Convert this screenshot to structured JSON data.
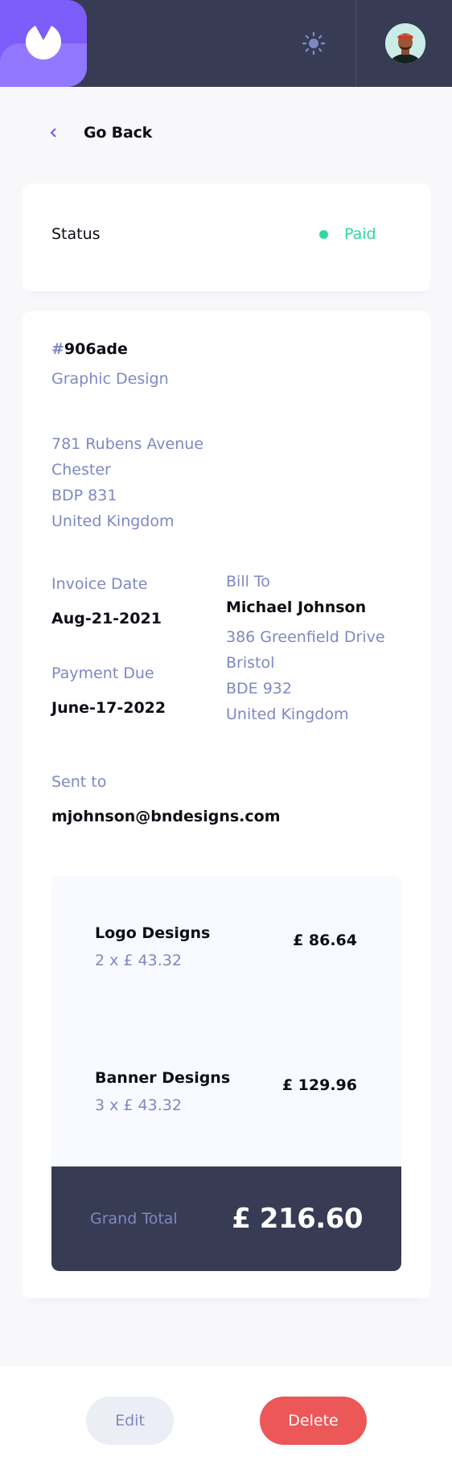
{
  "header": {
    "logo_icon": "logo-mark-icon",
    "theme_icon": "sun-icon",
    "avatar_alt": "user-avatar"
  },
  "nav": {
    "go_back_label": "Go Back",
    "go_back_icon": "chevron-left-icon"
  },
  "status": {
    "label": "Status",
    "value": "Paid",
    "color": "#33d69f"
  },
  "invoice": {
    "id_hash": "#",
    "id": "906ade",
    "description": "Graphic Design",
    "sender_address": [
      "781 Rubens Avenue",
      "Chester",
      "BDP 831",
      "United Kingdom"
    ],
    "invoice_date_label": "Invoice Date",
    "invoice_date": "Aug-21-2021",
    "payment_due_label": "Payment Due",
    "payment_due": "June-17-2022",
    "bill_to_label": "Bill To",
    "client_name": "Michael Johnson",
    "client_address": [
      "386 Greenfield Drive",
      "Bristol",
      "BDE 932",
      "United Kingdom"
    ],
    "sent_to_label": "Sent to",
    "client_email": "mjohnson@bndesigns.com",
    "items": [
      {
        "name": "Logo Designs",
        "qty": "2 x £ 43.32",
        "total": "£ 86.64"
      },
      {
        "name": "Banner Designs",
        "qty": "3 x £ 43.32",
        "total": "£ 129.96"
      }
    ],
    "grand_total_label": "Grand Total",
    "grand_total": "£ 216.60"
  },
  "actions": {
    "edit_label": "Edit",
    "delete_label": "Delete"
  },
  "colors": {
    "accent": "#7c5dfa",
    "header_bg": "#373b53",
    "delete": "#ec5757",
    "muted": "#7e88c3"
  }
}
